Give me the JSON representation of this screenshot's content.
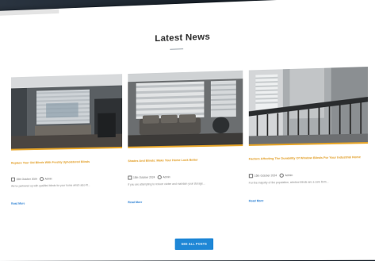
{
  "section": {
    "title": "Latest News"
  },
  "posts": [
    {
      "headline": "Replace Your Old Blinds With Freshly Upholstered Blinds",
      "date": "15th October 2024",
      "author": "Admin",
      "excerpt": "We've partnered up with qualified blinds for your home which also fit...",
      "more": "Read More"
    },
    {
      "headline": "Shades And Blinds: Make Your Home Look Better",
      "date": "15th October 2024",
      "author": "Admin",
      "excerpt": "If you are attempting to reduce clutter and maintain your storage...",
      "more": "Read More"
    },
    {
      "headline": "Factors Affecting The Durability Of Window Blinds For Your Industrial Home",
      "date": "15th October 2024",
      "author": "Admin",
      "excerpt": "For the majority of the population, window blinds are a core item...",
      "more": "Read More"
    }
  ],
  "cta": {
    "label": "SEE ALL POSTS"
  },
  "colors": {
    "accent_orange": "#e09a1e",
    "button_blue": "#1f87d6",
    "link_blue": "#2a7fd3",
    "backdrop": "#1b2530"
  }
}
